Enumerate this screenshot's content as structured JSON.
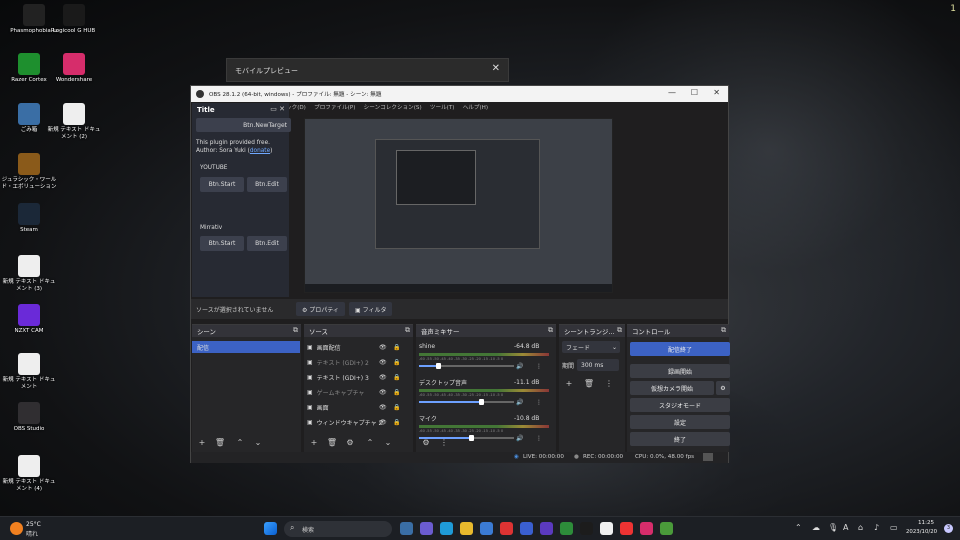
{
  "desktop": {
    "corner_number": "1",
    "icons": [
      {
        "label": "PhasmophobiaRu",
        "icon": "phasmophobia-icon",
        "color": "#222"
      },
      {
        "label": "Logicool G HUB",
        "icon": "ghub-icon",
        "color": "#1a1a1a"
      },
      {
        "label": "Razer Cortex",
        "icon": "razer-icon",
        "color": "#1e8f2e"
      },
      {
        "label": "Wondershare",
        "icon": "tiktok-studio-icon",
        "color": "#d62d6b"
      },
      {
        "label": "ごみ箱",
        "icon": "recycle-bin-icon",
        "color": "#3a6ea5"
      },
      {
        "label": "新規 テキスト ドキュメント (2)",
        "icon": "text-file-icon",
        "color": "#eeeeee"
      },
      {
        "label": "ジュラシック・ワールド・エボリューション",
        "icon": "jurassic-icon",
        "color": "#8a5a1a"
      },
      {
        "label": "Steam",
        "icon": "steam-icon",
        "color": "#1b2838"
      },
      {
        "label": "新規 テキスト ドキュメント (3)",
        "icon": "text-file-icon",
        "color": "#eeeeee"
      },
      {
        "label": "NZXT CAM",
        "icon": "nzxt-icon",
        "color": "#6a2ad8"
      },
      {
        "label": "新規 テキスト ドキュメント",
        "icon": "text-file-icon",
        "color": "#eeeeee"
      },
      {
        "label": "OBS Studio",
        "icon": "obs-icon",
        "color": "#302e31"
      },
      {
        "label": "新規 テキスト ドキュメント (4)",
        "icon": "text-file-icon",
        "color": "#eeeeee"
      }
    ]
  },
  "mobile_preview": {
    "title": "モバイルプレビュー",
    "close": "✕"
  },
  "obs": {
    "title": "OBS 28.1.2 (64-bit, windows) - プロファイル: 無題 - シーン: 無題",
    "window_controls": {
      "minimize": "—",
      "maximize": "☐",
      "close": "✕"
    },
    "menu": [
      "ック(D)",
      "プロファイル(P)",
      "シーンコレクション(S)",
      "ツール(T)",
      "ヘルプ(H)"
    ],
    "dock": {
      "title": "Title",
      "new_target": "Btn.NewTarget",
      "info_line1": "This plugin provided free.",
      "info_line2": "Author: Sora Yuki (",
      "donate": "donate",
      "info_line2_end": ")",
      "section1": "YOUTUBE",
      "section2": "Mirrativ",
      "start": "Btn.Start",
      "edit": "Btn.Edit"
    },
    "source_bar": {
      "no_source": "ソースが選択されていません",
      "properties": "⚙ プロパティ",
      "filters": "▣ フィルタ"
    },
    "scenes": {
      "header": "シーン",
      "items": [
        "配信"
      ],
      "add": "+",
      "remove": "🗑",
      "up": "⌃",
      "down": "⌄"
    },
    "sources": {
      "header": "ソース",
      "items": [
        {
          "name": "画面配信",
          "dim": false
        },
        {
          "name": "テキスト (GDI+) 2",
          "dim": true
        },
        {
          "name": "テキスト (GDI+) 3",
          "dim": false
        },
        {
          "name": "ゲームキャプチャ",
          "dim": true
        },
        {
          "name": "画面",
          "dim": false
        },
        {
          "name": "ウィンドウキャプチャ 2",
          "dim": false
        }
      ]
    },
    "mixer": {
      "header": "音声ミキサー",
      "ticks": "-60 -55 -50 -45 -40 -35 -30 -25 -20 -15 -10 -5 0",
      "channels": [
        {
          "name": "shine",
          "level": "-64.8 dB",
          "volume": 0.2
        },
        {
          "name": "デスクトップ音声",
          "level": "-11.1 dB",
          "volume": 0.65
        },
        {
          "name": "マイク",
          "level": "-10.8 dB",
          "volume": 0.55
        }
      ]
    },
    "transitions": {
      "header": "シーントランジ...",
      "type": "フェード",
      "duration_label": "期間",
      "duration": "300 ms"
    },
    "controls": {
      "header": "コントロール",
      "stop_stream": "配信終了",
      "start_record": "録画開始",
      "start_vcam": "仮想カメラ開始",
      "studio_mode": "スタジオモード",
      "settings": "設定",
      "exit": "終了"
    },
    "status": {
      "live": "LIVE: 00:00:00",
      "rec": "REC: 00:00:00",
      "cpu": "CPU: 0.0%, 48.00 fps"
    }
  },
  "taskbar": {
    "weather_temp": "25°C",
    "weather_desc": "晴れ",
    "search_placeholder": "検索",
    "time": "11:25",
    "date": "2023/10/20",
    "notification_count": "3",
    "ime": "A"
  }
}
